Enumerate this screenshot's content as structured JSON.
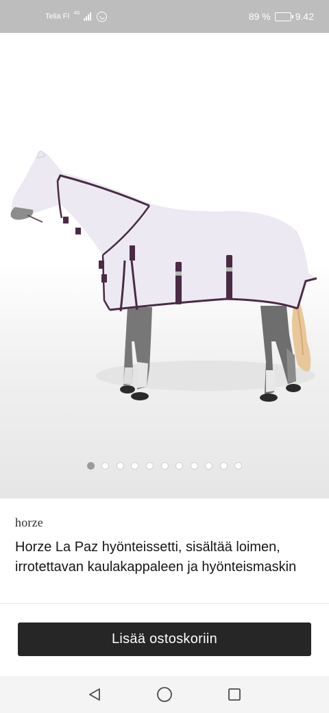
{
  "status_bar": {
    "carrier": "Telia FI",
    "network_tag": "4G",
    "battery": "89 %",
    "battery_level": 0.89,
    "time": "9.42"
  },
  "gallery": {
    "image_alt": "Horze La Paz insect set on a horse",
    "image_count": 11,
    "active_index": 0
  },
  "product": {
    "brand": "horze",
    "title": "Horze La Paz hyönteissetti, sisältää loimen, irrotettavan kaulakappaleen ja hyönteismaskin"
  },
  "cart": {
    "add_label": "Lisää ostoskoriin"
  },
  "navigation": {
    "buttons": [
      "back",
      "home",
      "recents"
    ]
  },
  "colors": {
    "status_bar_bg": "#bdbdbd",
    "button_bg": "#262626",
    "rug": "#ece9f3",
    "rug_trim": "#4a2a44"
  }
}
